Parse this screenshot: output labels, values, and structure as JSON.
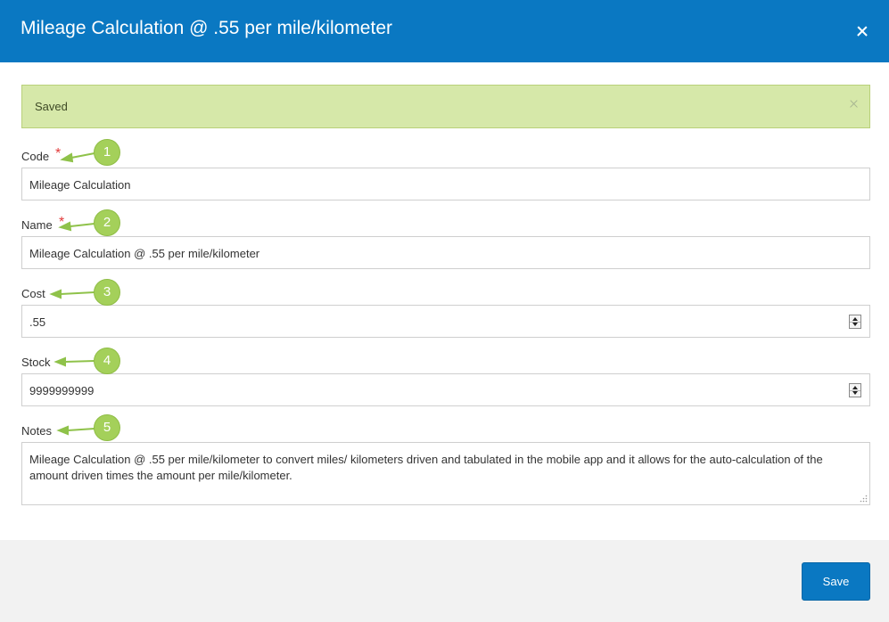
{
  "modal": {
    "title": "Mileage Calculation @ .55 per mile/kilometer",
    "close_icon": "close-icon",
    "header_color": "#0a78c2"
  },
  "alert": {
    "message": "Saved",
    "dismiss_icon": "close-icon",
    "background_color": "#d6e8a9"
  },
  "form": {
    "required_marker": "*",
    "code": {
      "label": "Code",
      "value": "Mileage Calculation",
      "required": true
    },
    "name": {
      "label": "Name",
      "value": "Mileage Calculation @ .55 per mile/kilometer",
      "required": true
    },
    "cost": {
      "label": "Cost",
      "value": ".55"
    },
    "stock": {
      "label": "Stock",
      "value": "9999999999"
    },
    "notes": {
      "label": "Notes",
      "value": "Mileage Calculation @ .55 per mile/kilometer to convert miles/ kilometers  driven and tabulated in the mobile app and it allows for  the auto-calculation of the amount driven  times the amount per mile/kilometer."
    }
  },
  "callouts": [
    "1",
    "2",
    "3",
    "4",
    "5"
  ],
  "callout_color": "#a4d05a",
  "footer": {
    "save_label": "Save"
  }
}
